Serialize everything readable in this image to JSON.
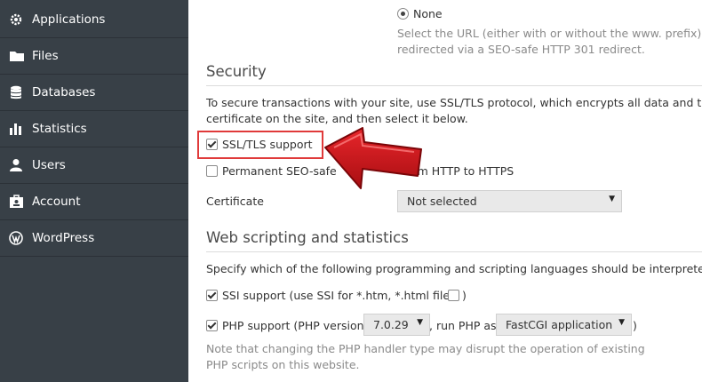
{
  "sidebar": {
    "items": [
      {
        "label": "Applications",
        "icon": "gear-icon"
      },
      {
        "label": "Files",
        "icon": "folder-icon"
      },
      {
        "label": "Databases",
        "icon": "database-icon"
      },
      {
        "label": "Statistics",
        "icon": "bar-chart-icon"
      },
      {
        "label": "Users",
        "icon": "user-icon"
      },
      {
        "label": "Account",
        "icon": "account-icon"
      },
      {
        "label": "WordPress",
        "icon": "wordpress-icon"
      }
    ]
  },
  "redirect": {
    "none_label": "None",
    "note_line1": "Select the URL (either with or without the www. prefix) to",
    "note_line2": "redirected via a SEO-safe HTTP 301 redirect."
  },
  "security": {
    "title": "Security",
    "desc_line1": "To secure transactions with your site, use SSL/TLS protocol, which encrypts all data and trans",
    "desc_line2": "certificate on the site, and then select it below.",
    "ssl_label": "SSL/TLS support",
    "ssl_checked": true,
    "redirect_label_start": "Permanent SEO-safe",
    "redirect_label_end": "om HTTP to HTTPS",
    "redirect_checked": false,
    "certificate_label": "Certificate",
    "certificate_value": "Not selected"
  },
  "web_scripting": {
    "title": "Web scripting and statistics",
    "desc": "Specify which of the following programming and scripting languages should be interpreted, e",
    "ssi_label": "SSI support (use SSI for *.htm, *.html files",
    "ssi_paren_close": ")",
    "php_label": "PHP support (PHP version",
    "php_version": "7.0.29",
    "php_run_as": ", run PHP as",
    "php_handler": "FastCGI application",
    "php_paren_close": ")",
    "note_line1": "Note that changing the PHP handler type may disrupt the operation of existing",
    "note_line2": "PHP scripts on this website."
  },
  "colors": {
    "sidebar_bg": "#384047",
    "highlight": "#e03a3a",
    "arrow": "#c8161d"
  }
}
